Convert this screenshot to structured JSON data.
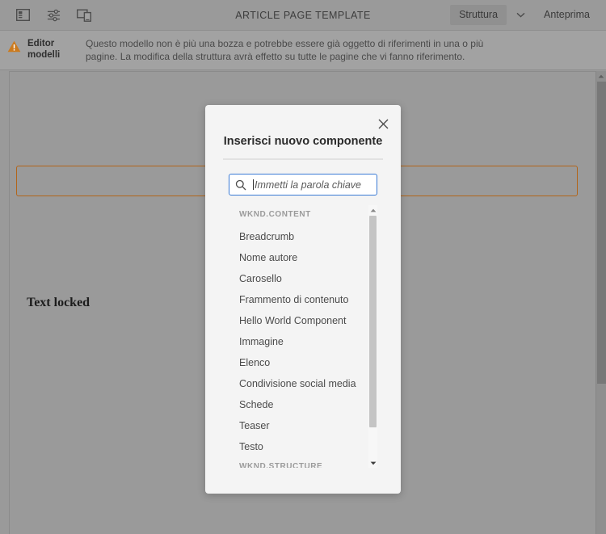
{
  "toolbar": {
    "title": "ARTICLE PAGE TEMPLATE",
    "icons": [
      {
        "name": "side-panel-toggle-icon",
        "label": "Pannello laterale"
      },
      {
        "name": "page-properties-icon",
        "label": "Proprietà pagina"
      },
      {
        "name": "responsive-layout-icon",
        "label": "Layout responsivo"
      }
    ],
    "mode_label": "Struttura",
    "chevron_icon": "chevron-down-icon",
    "preview_label": "Anteprima"
  },
  "banner": {
    "icon": "warning-triangle-icon",
    "icon_color": "#cc7a1d",
    "label": "Editor modelli",
    "message": "Questo modello non è più una bozza e potrebbe essere già oggetto di riferimenti in una o più pagine. La modifica della struttura avrà effetto su tutte le pagine che vi fanno riferimento."
  },
  "canvas": {
    "ghost_heading": "",
    "text_locked": "Text locked",
    "highlight_color": "#b2651a"
  },
  "modal": {
    "title": "Inserisci nuovo componente",
    "close_icon": "close-icon",
    "search": {
      "icon": "search-icon",
      "placeholder": "Immetti la parola chiave",
      "value": ""
    },
    "groups": [
      {
        "name": "WKND.CONTENT",
        "items": [
          "Breadcrumb",
          "Nome autore",
          "Carosello",
          "Frammento di contenuto",
          "Hello World Component",
          "Immagine",
          "Elenco",
          "Condivisione social media",
          "Schede",
          "Teaser",
          "Testo"
        ]
      },
      {
        "name": "WKND.STRUCTURE",
        "items": []
      }
    ],
    "scrollbar": {
      "up_icon": "caret-up-icon",
      "down_icon": "caret-down-icon"
    }
  },
  "page_scrollbar": {
    "up_icon": "caret-up-icon"
  },
  "colors": {
    "overlay": "#9a9a9a",
    "modal_bg": "#f4f4f4",
    "focus_blue": "#3a7ad4",
    "accent_orange": "#b2651a"
  }
}
